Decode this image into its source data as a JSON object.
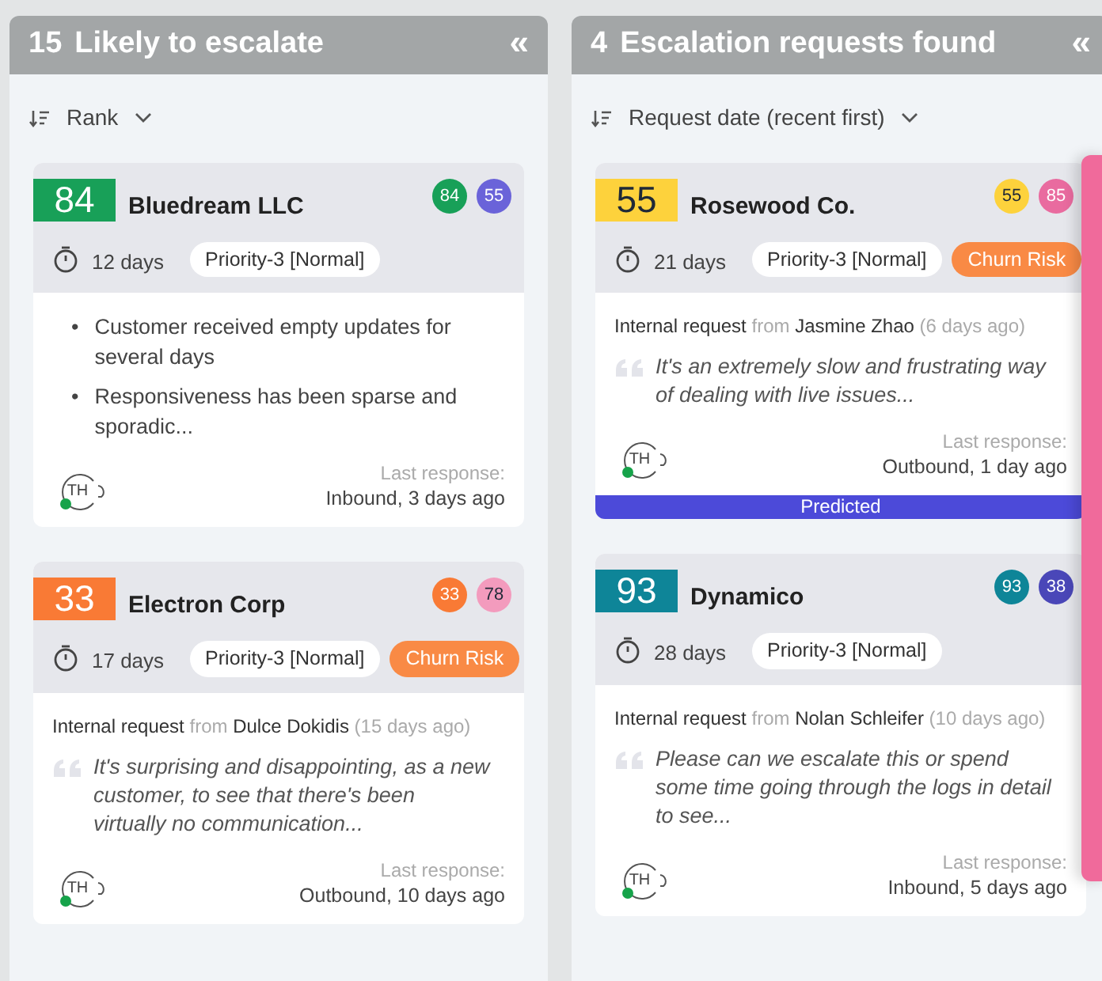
{
  "columns": [
    {
      "count": "15",
      "title": "Likely to escalate",
      "collapse": "«",
      "sort": {
        "label": "Rank"
      },
      "cards": [
        {
          "score": "84",
          "color": "#18a058",
          "name": "Bluedream LLC",
          "circles": [
            {
              "label": "84",
              "color": "#18a058"
            },
            {
              "label": "55",
              "color": "#6a63d9"
            }
          ],
          "duration": "12 days",
          "tags": [
            {
              "label": "Priority-3 [Normal]",
              "kind": "priority"
            }
          ],
          "body": {
            "kind": "bullets",
            "marker": "•",
            "items": [
              "Customer received empty updates for several days",
              "Responsiveness has been sparse and sporadic..."
            ]
          },
          "avatar": "TH",
          "online": true,
          "last_response_label": "Last response:",
          "last_response": "Inbound, 3 days ago"
        },
        {
          "score": "33",
          "color": "#f97a35",
          "name": "Electron Corp",
          "circles": [
            {
              "label": "33",
              "color": "#f97a35"
            },
            {
              "label": "78",
              "color": "#f39bbd"
            }
          ],
          "duration": "17 days",
          "tags": [
            {
              "label": "Priority-3 [Normal]",
              "kind": "priority"
            },
            {
              "label": "Churn Risk",
              "kind": "churn"
            }
          ],
          "body": {
            "kind": "request",
            "label": "Internal request",
            "from": "from",
            "requester": "Dulce Dokidis",
            "ago": "(15 days ago)",
            "quote": "It's surprising and disappointing, as a new customer, to see that there's been virtually no communication..."
          },
          "avatar": "TH",
          "online": true,
          "last_response_label": "Last response:",
          "last_response": "Outbound, 10 days ago"
        }
      ]
    },
    {
      "count": "4",
      "title": "Escalation requests found",
      "collapse": "«",
      "sort": {
        "label": "Request date (recent first)"
      },
      "cards": [
        {
          "score": "55",
          "color": "#fdd23c",
          "name": "Rosewood Co.",
          "circles": [
            {
              "label": "55",
              "color": "#fdd23c"
            },
            {
              "label": "85",
              "color": "#e96b9f"
            }
          ],
          "duration": "21 days",
          "tags": [
            {
              "label": "Priority-3 [Normal]",
              "kind": "priority"
            },
            {
              "label": "Churn Risk",
              "kind": "churn"
            }
          ],
          "body": {
            "kind": "request",
            "label": "Internal request",
            "from": "from",
            "requester": "Jasmine Zhao",
            "ago": "(6 days ago)",
            "quote": "It's an extremely slow and frustrating way of dealing with live issues..."
          },
          "avatar": "TH",
          "online": true,
          "last_response_label": "Last response:",
          "last_response": "Outbound, 1 day ago",
          "banner": "Predicted"
        },
        {
          "score": "93",
          "color": "#0e8598",
          "name": "Dynamico",
          "circles": [
            {
              "label": "93",
              "color": "#0e8598"
            },
            {
              "label": "38",
              "color": "#4a47b8"
            }
          ],
          "duration": "28 days",
          "tags": [
            {
              "label": "Priority-3 [Normal]",
              "kind": "priority"
            }
          ],
          "body": {
            "kind": "request",
            "label": "Internal request",
            "from": "from",
            "requester": "Nolan Schleifer",
            "ago": "(10 days ago)",
            "quote": "Please can we escalate this or spend some time going through the logs in detail to see..."
          },
          "avatar": "TH",
          "online": true,
          "last_response_label": "Last response:",
          "last_response": "Inbound, 5 days ago"
        }
      ]
    }
  ]
}
